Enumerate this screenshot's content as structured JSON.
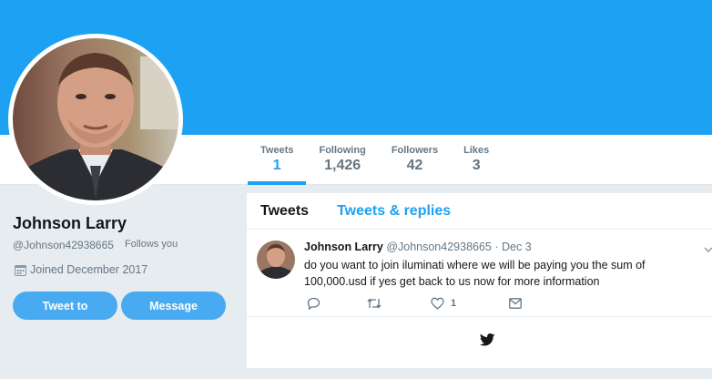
{
  "profile": {
    "name": "Johnson Larry",
    "handle": "@Johnson42938665",
    "follows_you": "Follows you",
    "joined": "Joined December 2017",
    "tweet_to_label": "Tweet to",
    "message_label": "Message"
  },
  "stats": [
    {
      "label": "Tweets",
      "value": "1"
    },
    {
      "label": "Following",
      "value": "1,426"
    },
    {
      "label": "Followers",
      "value": "42"
    },
    {
      "label": "Likes",
      "value": "3"
    }
  ],
  "tabs": [
    {
      "label": "Tweets"
    },
    {
      "label": "Tweets & replies"
    }
  ],
  "tweet": {
    "name": "Johnson Larry",
    "handle": "@Johnson42938665",
    "date": "· Dec 3",
    "text": "do you want to join iluminati where we will be paying you the sum of 100,000.usd if yes get back to us now for more information",
    "like_count": "1"
  },
  "colors": {
    "accent": "#1da1f2",
    "banner": "#1da1f2",
    "button": "#48aaf0",
    "background": "#e6ecf0"
  },
  "icons": [
    "calendar-icon",
    "reply-icon",
    "retweet-icon",
    "heart-icon",
    "direct-message-icon",
    "chevron-down-icon",
    "twitter-bird-icon"
  ]
}
